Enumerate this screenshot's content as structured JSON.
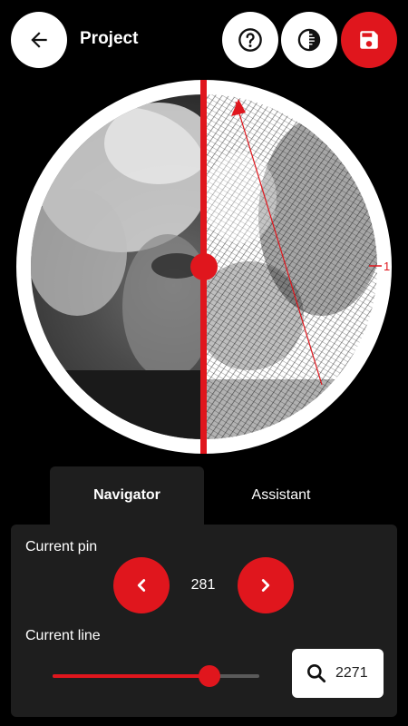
{
  "header": {
    "title": "Project",
    "back_icon": "arrow-left-icon",
    "help_icon": "help-circle-icon",
    "contrast_icon": "contrast-icon",
    "save_icon": "save-icon",
    "accent_color": "#e0161d"
  },
  "preview": {
    "pin_marker_label": "1"
  },
  "tabs": [
    {
      "label": "Navigator",
      "active": true
    },
    {
      "label": "Assistant",
      "active": false
    }
  ],
  "navigator": {
    "current_pin_label": "Current pin",
    "current_pin_value": "281",
    "current_line_label": "Current line",
    "current_line_value": "2271",
    "line_slider_fraction": 0.76,
    "prev_icon": "chevron-left-icon",
    "next_icon": "chevron-right-icon",
    "search_icon": "search-icon"
  }
}
